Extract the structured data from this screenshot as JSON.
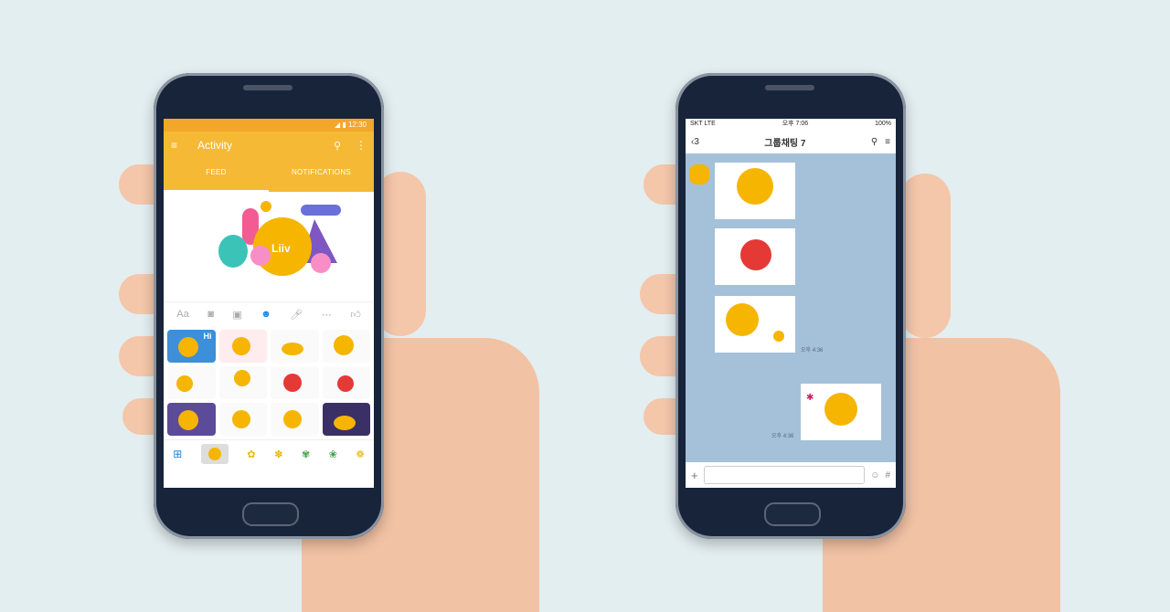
{
  "left_phone": {
    "status_time": "12:30",
    "appbar": {
      "title": "Activity"
    },
    "tabs": [
      "FEED",
      "NOTIFICATIONS"
    ],
    "hero_sticker_text": "Liiv",
    "toolbar_text_icon": "Aa",
    "grid_sticker_text": "Hi"
  },
  "right_phone": {
    "status": {
      "carrier": "SKT  LTE",
      "time": "오후 7:06",
      "battery": "100%"
    },
    "nav": {
      "back_count": "3",
      "title": "그룹채팅 7"
    },
    "messages": [
      {
        "time": ""
      },
      {
        "time": ""
      },
      {
        "time": "오후 4:36"
      },
      {
        "time": "오후 4:36"
      }
    ],
    "input_hash": "#"
  },
  "colors": {
    "background": "#e3eef0",
    "appbar_yellow": "#f5b935",
    "chat_blue": "#a5c0d9",
    "phone_navy": "#17243a"
  }
}
